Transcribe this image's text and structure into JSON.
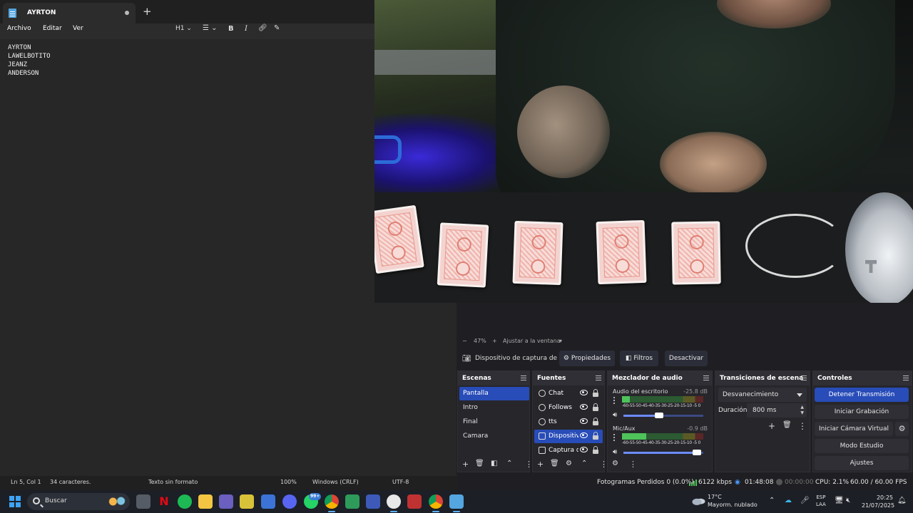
{
  "notepad": {
    "tab_title": "AYRTON",
    "new_tab_glyph": "+",
    "menu": [
      "Archivo",
      "Editar",
      "Ver"
    ],
    "toolbar": {
      "heading": "H1",
      "heading_chevron": "⌄",
      "list_chevron": "⌄",
      "bold": "B",
      "italic": "I"
    },
    "lines": [
      "AYRTON",
      "LAWELBOTITO",
      "JEANZ",
      "ANDERSON"
    ],
    "status": {
      "position": "Ln 5, Col 1",
      "chars": "34 caracteres.",
      "format": "Texto sin formato",
      "zoom": "100%",
      "line_ending": "Windows (CRLF)",
      "encoding": "UTF-8"
    }
  },
  "obs": {
    "zoom_bar": {
      "minus": "−",
      "zoom": "47%",
      "plus": "+",
      "fit": "Ajustar a la ventana"
    },
    "source_bar": {
      "source_name": "Dispositivo de captura de v",
      "properties": "Propiedades",
      "filters": "Filtros",
      "deactivate": "Desactivar"
    },
    "scenes": {
      "title": "Escenas",
      "items": [
        "Pantalla",
        "Intro",
        "Final",
        "Camara"
      ],
      "selected": "Pantalla"
    },
    "sources": {
      "title": "Fuentes",
      "items": [
        {
          "label": "Chat",
          "selected": false
        },
        {
          "label": "Follows",
          "selected": false
        },
        {
          "label": "tts",
          "selected": false
        },
        {
          "label": "Dispositivo",
          "selected": true
        },
        {
          "label": "Captura d",
          "selected": false
        }
      ]
    },
    "mixer": {
      "title": "Mezclador de audio",
      "scale": "-60-55-50-45-40-35-30-25-20-15-10 -5 0",
      "channels": [
        {
          "name": "Audio del escritorio",
          "db": "-25.8 dB",
          "level": 0.1,
          "volume": 0.45
        },
        {
          "name": "Mic/Aux",
          "db": "-0.9 dB",
          "level": 0.3,
          "volume": 0.92
        }
      ]
    },
    "transitions": {
      "title": "Transiciones de escena",
      "selected": "Desvanecimiento",
      "duration_label": "Duración",
      "duration_value": "800 ms"
    },
    "controls": {
      "title": "Controles",
      "buttons": [
        "Detener Transmisión",
        "Iniciar Grabación",
        "Iniciar Cámara Virtual",
        "Modo Estudio",
        "Ajustes"
      ]
    },
    "status": {
      "dropped": "Fotogramas Perdidos 0 (0.0%)",
      "bitrate": "6122 kbps",
      "stream_time": "01:48:08",
      "rec_time": "00:00:00",
      "cpu": "CPU: 2.1%",
      "fps": "60.00 / 60.00 FPS"
    }
  },
  "taskbar": {
    "search_label": "Buscar",
    "whatsapp_badge": "99+",
    "weather_temp": "17°C",
    "weather_desc": "Mayorm. nublado",
    "lang_top": "ESP",
    "lang_bottom": "LAA",
    "time": "20:25",
    "date": "21/07/2025"
  },
  "colors": {
    "accent": "#284cb8",
    "meter_green": "#4ec35a",
    "windows_blue": "#3ea3f5"
  }
}
